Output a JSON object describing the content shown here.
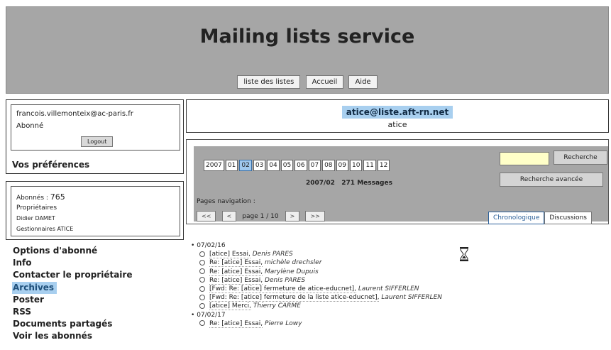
{
  "header": {
    "title": "Mailing lists service",
    "nav": [
      "liste des listes",
      "Accueil",
      "Aide"
    ]
  },
  "user": {
    "email": "francois.villemonteix@ac-paris.fr",
    "status": "Abonné",
    "logout_label": "Logout",
    "preferences_label": "Vos préférences"
  },
  "listinfo": {
    "subscribers_label": "Abonnés :",
    "subscribers_count": "765",
    "owners_label": "Propriétaires",
    "owner_name": "Didier DAMET",
    "managers_label": "Gestionnaires ATICE"
  },
  "menu": {
    "items": [
      "Options d'abonné",
      "Info",
      "Contacter le propriétaire",
      "Archives",
      "Poster",
      "RSS",
      "Documents partagés",
      "Voir les abonnés"
    ],
    "active_index": 3
  },
  "list": {
    "address": "atice@liste.aft-rn.net",
    "name": "atice"
  },
  "archive": {
    "year": "2007",
    "months": [
      "01",
      "02",
      "03",
      "04",
      "05",
      "06",
      "07",
      "08",
      "09",
      "10",
      "11",
      "12"
    ],
    "selected_month": "02",
    "summary_period": "2007/02",
    "summary_count": "271 Messages",
    "search_label": "Recherche",
    "advanced_search_label": "Recherche avancée",
    "pages_nav_label": "Pages navigation :",
    "first_label": "<<",
    "prev_label": "<",
    "page_label": "page 1 / 10",
    "next_label": ">",
    "last_label": ">>",
    "tab_chrono": "Chronologique",
    "tab_threads": "Discussions"
  },
  "messages": [
    {
      "date": "07/02/16",
      "items": [
        {
          "subject": "[atice] Essai,",
          "author": "Denis PARES"
        },
        {
          "subject": "Re: [atice] Essai,",
          "author": "michèle drechsler"
        },
        {
          "subject": "Re: [atice] Essai,",
          "author": "Marylène Dupuis"
        },
        {
          "subject": "Re: [atice] Essai,",
          "author": "Denis PARES"
        },
        {
          "subject": "[Fwd: Re: [atice] fermeture de atice-educnet],",
          "author": "Laurent SIFFERLEN"
        },
        {
          "subject": "[Fwd: Re: [atice] fermeture de la liste atice-educnet],",
          "author": "Laurent SIFFERLEN"
        },
        {
          "subject": "[atice] Merci,",
          "author": "Thierry CARME"
        }
      ]
    },
    {
      "date": "07/02/17",
      "items": [
        {
          "subject": "Re: [atice] Essai,",
          "author": "Pierre Lowy"
        }
      ]
    }
  ]
}
